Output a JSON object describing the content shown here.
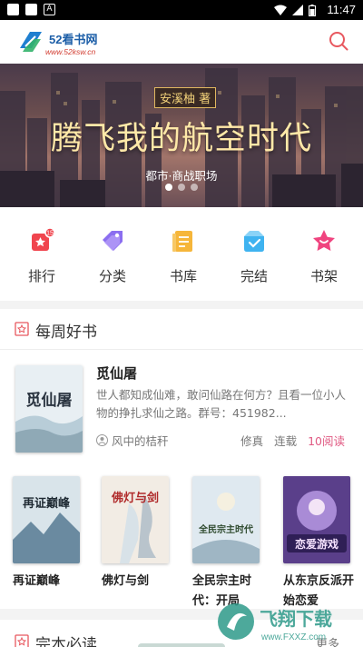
{
  "status_bar": {
    "time": "11:47"
  },
  "header": {
    "logo_name": "52看书网",
    "logo_url": "www.52ksw.cn",
    "search_icon": "search-icon"
  },
  "banner": {
    "author": "安溪柚 著",
    "title": "腾飞我的航空时代",
    "genre": "都市·商战职场",
    "slide_count": 3,
    "active_slide": 1
  },
  "nav": [
    {
      "label": "排行",
      "icon": "ranking-icon",
      "color": "#f0454e"
    },
    {
      "label": "分类",
      "icon": "category-icon",
      "color": "#8b6ef0"
    },
    {
      "label": "书库",
      "icon": "library-icon",
      "color": "#f6b63a"
    },
    {
      "label": "完结",
      "icon": "completed-icon",
      "color": "#3fb3f0"
    },
    {
      "label": "书架",
      "icon": "bookshelf-icon",
      "color": "#f0447f"
    }
  ],
  "weekly": {
    "title": "每周好书",
    "featured": {
      "title": "觅仙屠",
      "description": "世人都知成仙难，敢问仙路在何方？且看一位小人物的挣扎求仙之路。群号：451982...",
      "author": "风中的桔秆",
      "tags": [
        "修真",
        "连载"
      ],
      "reads": "10阅读",
      "cover_text": "觅仙屠"
    },
    "books": [
      {
        "title": "再证巅峰",
        "cover_text": "再证巅峰"
      },
      {
        "title": "佛灯与剑",
        "cover_text": "佛灯与剑"
      },
      {
        "title": "全民宗主时代：开局",
        "cover_text": "全民宗主时代"
      },
      {
        "title": "从东京反派开始恋爱",
        "cover_text": "恋爱游戏"
      }
    ]
  },
  "bottom": {
    "title": "完本必读",
    "more": "更多"
  },
  "watermark": {
    "text": "飞翔下载",
    "url": "www.FXXZ.com"
  }
}
